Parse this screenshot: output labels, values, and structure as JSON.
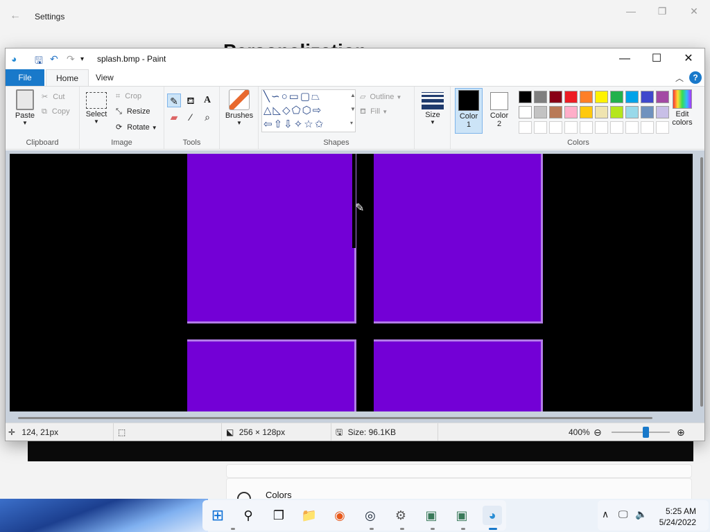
{
  "settings": {
    "title": "Settings",
    "back_icon": "back-arrow-icon",
    "heading": "Personalization",
    "colors_label": "Colors"
  },
  "paint": {
    "window_title": "splash.bmp - Paint",
    "tabs": {
      "file": "File",
      "home": "Home",
      "view": "View"
    },
    "ribbon": {
      "clipboard": {
        "label": "Clipboard",
        "paste": "Paste",
        "cut": "Cut",
        "copy": "Copy"
      },
      "image": {
        "label": "Image",
        "select": "Select",
        "crop": "Crop",
        "resize": "Resize",
        "rotate": "Rotate"
      },
      "tools": {
        "label": "Tools"
      },
      "brushes": {
        "label": "Brushes"
      },
      "shapes": {
        "label": "Shapes",
        "outline": "Outline",
        "fill": "Fill"
      },
      "size": {
        "label": "Size"
      },
      "colors": {
        "label": "Colors",
        "color1": "Color",
        "color1_num": "1",
        "color2": "Color",
        "color2_num": "2",
        "edit_colors": "Edit",
        "edit_colors_2": "colors",
        "palette_row1": [
          "#000000",
          "#7f7f7f",
          "#880015",
          "#ed1c24",
          "#ff7f27",
          "#fff200",
          "#22b14c",
          "#00a2e8",
          "#3f48cc",
          "#a349a4"
        ],
        "palette_row2": [
          "#ffffff",
          "#c3c3c3",
          "#b97a57",
          "#ffaec9",
          "#ffc90e",
          "#efe4b0",
          "#b5e61d",
          "#99d9ea",
          "#7092be",
          "#c8bfe7"
        ]
      }
    },
    "canvas_color": "#7300d6",
    "status": {
      "cursor_pos": "124, 21px",
      "image_size": "256 × 128px",
      "file_size": "Size: 96.1KB",
      "zoom": "400%",
      "zoom_level": 0.6
    }
  },
  "taskbar": {
    "time": "5:25 AM",
    "date": "5/24/2022"
  }
}
